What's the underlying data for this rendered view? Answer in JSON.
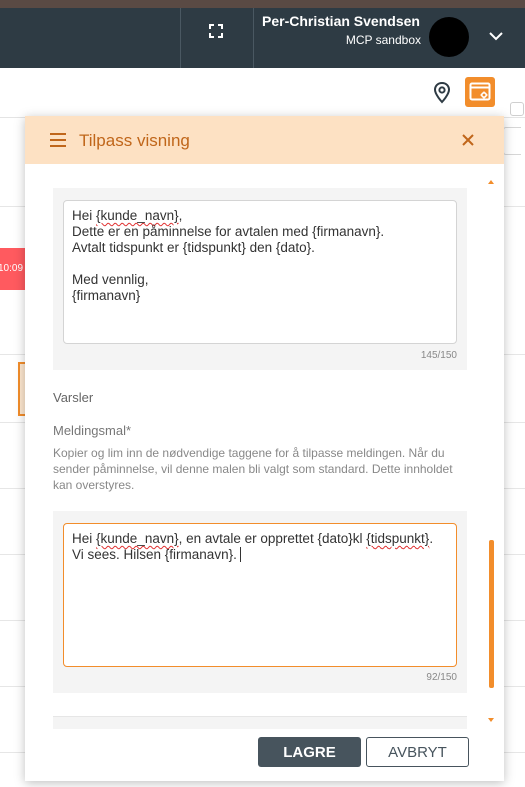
{
  "topbar": {
    "user_name": "Per-Christian Svendsen",
    "user_org": "MCP sandbox"
  },
  "background": {
    "time_label": "10:09"
  },
  "panel": {
    "title": "Tilpass visning",
    "email_template": {
      "greeting_prefix": "Hei ",
      "greeting_tag": "{kunde_navn}",
      "greeting_suffix": ",",
      "body_rest": "Dette er en påminnelse for avtalen med {firmanavn}.\nAvtalt tidspunkt er {tidspunkt} den {dato}.\n\nMed vennlig,\n{firmanavn}",
      "counter": "145/150"
    },
    "alerts_heading": "Varsler",
    "message_template_label": "Meldingsmal*",
    "message_template_help": "Kopier og lim inn de nødvendige taggene for å tilpasse meldingen. Når du sender påminnelse, vil denne malen bli valgt som standard. Dette innholdet kan overstyres.",
    "sms_template": {
      "prefix": "Hei ",
      "tag_name": "{kunde_navn}",
      "middle": ", en avtale er opprettet {dato}kl ",
      "tag_time": "{tidspunkt}",
      "suffix": ". Vi sees. Hilsen {firmanavn}.",
      "counter": "92/150"
    },
    "save_label": "LAGRE",
    "cancel_label": "AVBRYT"
  },
  "colors": {
    "accent": "#f28d2b",
    "header_bg": "#fde1c3",
    "topbar_bg": "#2e3b44",
    "primary_button": "#47545d"
  }
}
